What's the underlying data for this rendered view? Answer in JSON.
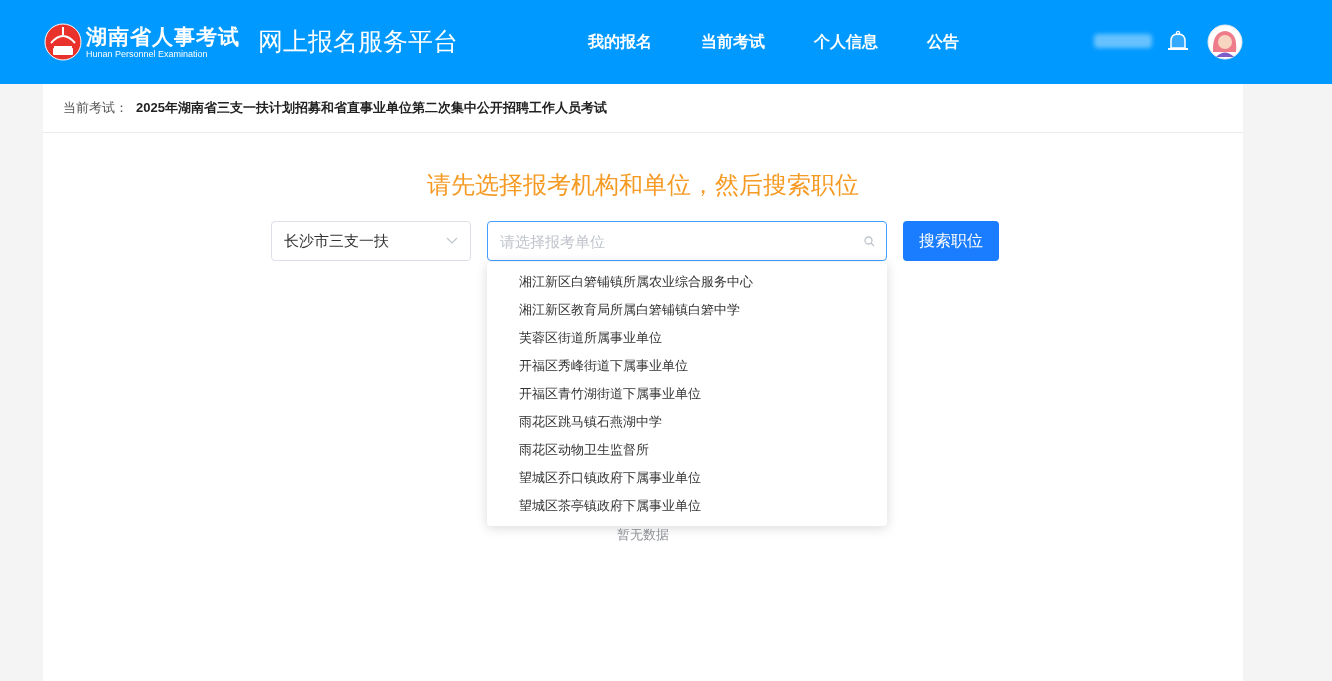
{
  "header": {
    "logo_title": "湖南省人事考试",
    "logo_subtitle": "Hunan Personnel Examination",
    "platform_title": "网上报名服务平台",
    "nav": [
      {
        "label": "我的报名"
      },
      {
        "label": "当前考试"
      },
      {
        "label": "个人信息"
      },
      {
        "label": "公告"
      }
    ]
  },
  "current_exam": {
    "label": "当前考试：",
    "value": "2025年湖南省三支一扶计划招募和省直事业单位第二次集中公开招聘工作人员考试"
  },
  "prompt": "请先选择报考机构和单位，然后搜索职位",
  "org_select": {
    "value": "长沙市三支一扶"
  },
  "unit_field": {
    "placeholder": "请选择报考单位",
    "expanded": true
  },
  "search_button": "搜索职位",
  "dropdown_options": [
    {
      "label": "湘江新区白箬铺镇所属农业综合服务中心"
    },
    {
      "label": "湘江新区教育局所属白箬铺镇白箬中学"
    },
    {
      "label": "芙蓉区街道所属事业单位"
    },
    {
      "label": "开福区秀峰街道下属事业单位"
    },
    {
      "label": "开福区青竹湖街道下属事业单位"
    },
    {
      "label": "雨花区跳马镇石燕湖中学"
    },
    {
      "label": "雨花区动物卫生监督所"
    },
    {
      "label": "望城区乔口镇政府下属事业单位"
    },
    {
      "label": "望城区茶亭镇政府下属事业单位"
    }
  ],
  "empty_text": "暂无数据"
}
